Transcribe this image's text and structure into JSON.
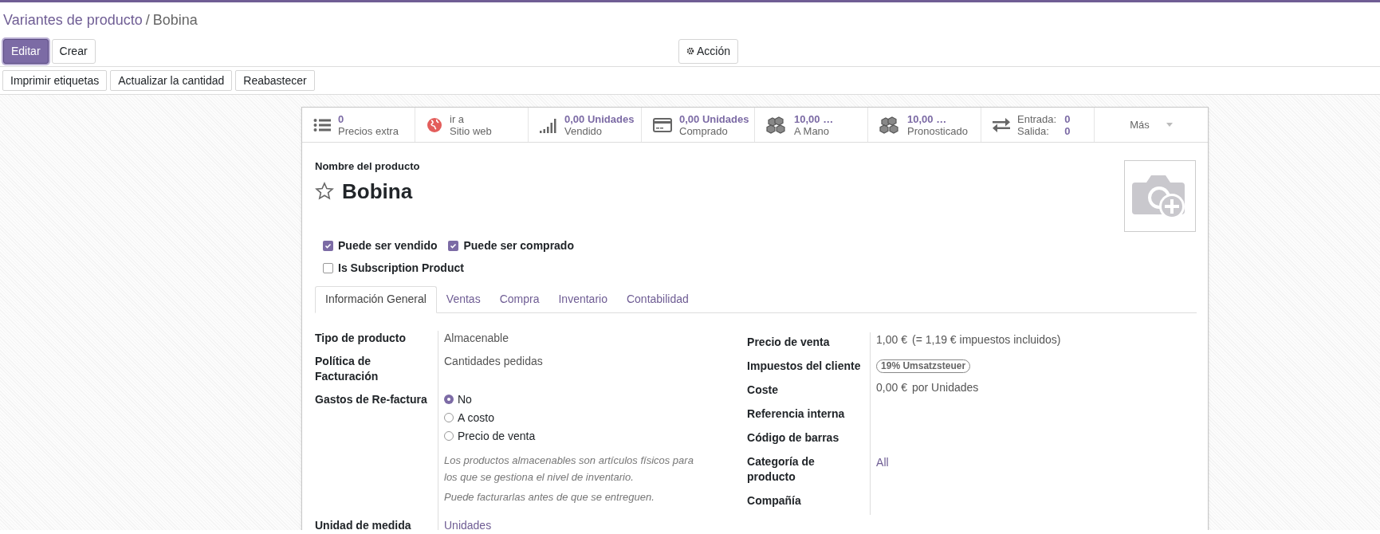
{
  "breadcrumb": {
    "parent": "Variantes de producto",
    "separator": "/",
    "current": "Bobina"
  },
  "main_buttons": [
    {
      "label": "Editar",
      "kind": "primary"
    },
    {
      "label": "Crear",
      "kind": "secondary"
    }
  ],
  "action_button": {
    "label": "Acción"
  },
  "secondary_buttons": [
    "Imprimir etiquetas",
    "Actualizar la cantidad",
    "Reabastecer"
  ],
  "stat_buttons": [
    {
      "kind": "list",
      "value": "0",
      "label": "Precios extra"
    },
    {
      "kind": "globe",
      "value": "ir a",
      "label": "Sitio web"
    },
    {
      "kind": "bars",
      "value": "0,00 Unidades",
      "label": "Vendido"
    },
    {
      "kind": "card",
      "value": "0,00 Unidades",
      "label": "Comprado"
    },
    {
      "kind": "cubes",
      "value": "10,00 …",
      "label": "A Mano"
    },
    {
      "kind": "cubes",
      "value": "10,00 …",
      "label": "Pronosticado"
    },
    {
      "kind": "inout",
      "lines": [
        {
          "label": "Entrada:",
          "value": "0"
        },
        {
          "label": "Salida:",
          "value": "0"
        }
      ]
    },
    {
      "kind": "more",
      "label": "Más"
    }
  ],
  "product": {
    "name_label": "Nombre del producto",
    "name": "Bobina",
    "favorite": false
  },
  "checkboxes": [
    [
      {
        "label": "Puede ser vendido",
        "checked": true
      },
      {
        "label": "Puede ser comprado",
        "checked": true
      }
    ],
    [
      {
        "label": "Is Subscription Product",
        "checked": false
      }
    ]
  ],
  "tabs": [
    {
      "label": "Información General",
      "selected": true
    },
    {
      "label": "Ventas",
      "selected": false
    },
    {
      "label": "Compra",
      "selected": false
    },
    {
      "label": "Inventario",
      "selected": false
    },
    {
      "label": "Contabilidad",
      "selected": false
    }
  ],
  "left_fields": [
    {
      "kind": "text",
      "label": "Tipo de producto",
      "value": "Almacenable"
    },
    {
      "kind": "text",
      "label": "Política de Facturación",
      "value": "Cantidades pedidas"
    },
    {
      "kind": "radio",
      "label": "Gastos de Re-factura",
      "options": [
        {
          "label": "No",
          "selected": true
        },
        {
          "label": "A costo",
          "selected": false
        },
        {
          "label": "Precio de venta",
          "selected": false
        }
      ]
    },
    {
      "kind": "help",
      "paragraphs": [
        "Los productos almacenables son artículos físicos para los que se gestiona el nivel de inventario.",
        "Puede facturarlas antes de que se entreguen."
      ]
    },
    {
      "kind": "link",
      "label": "Unidad de medida",
      "value": "Unidades"
    }
  ],
  "right_fields": [
    {
      "kind": "text",
      "label": "Precio de venta",
      "value": "1,00 €",
      "extra": "(= 1,19 € impuestos incluidos)"
    },
    {
      "kind": "tag",
      "label": "Impuestos del cliente",
      "value": "19% Umsatzsteuer"
    },
    {
      "kind": "text",
      "label": "Coste",
      "value": "0,00 €",
      "extra": "por Unidades"
    },
    {
      "kind": "empty",
      "label": "Referencia interna"
    },
    {
      "kind": "empty",
      "label": "Código de barras"
    },
    {
      "kind": "link",
      "label": "Categoría de producto",
      "value": "All"
    },
    {
      "kind": "empty",
      "label": "Compañía"
    }
  ]
}
